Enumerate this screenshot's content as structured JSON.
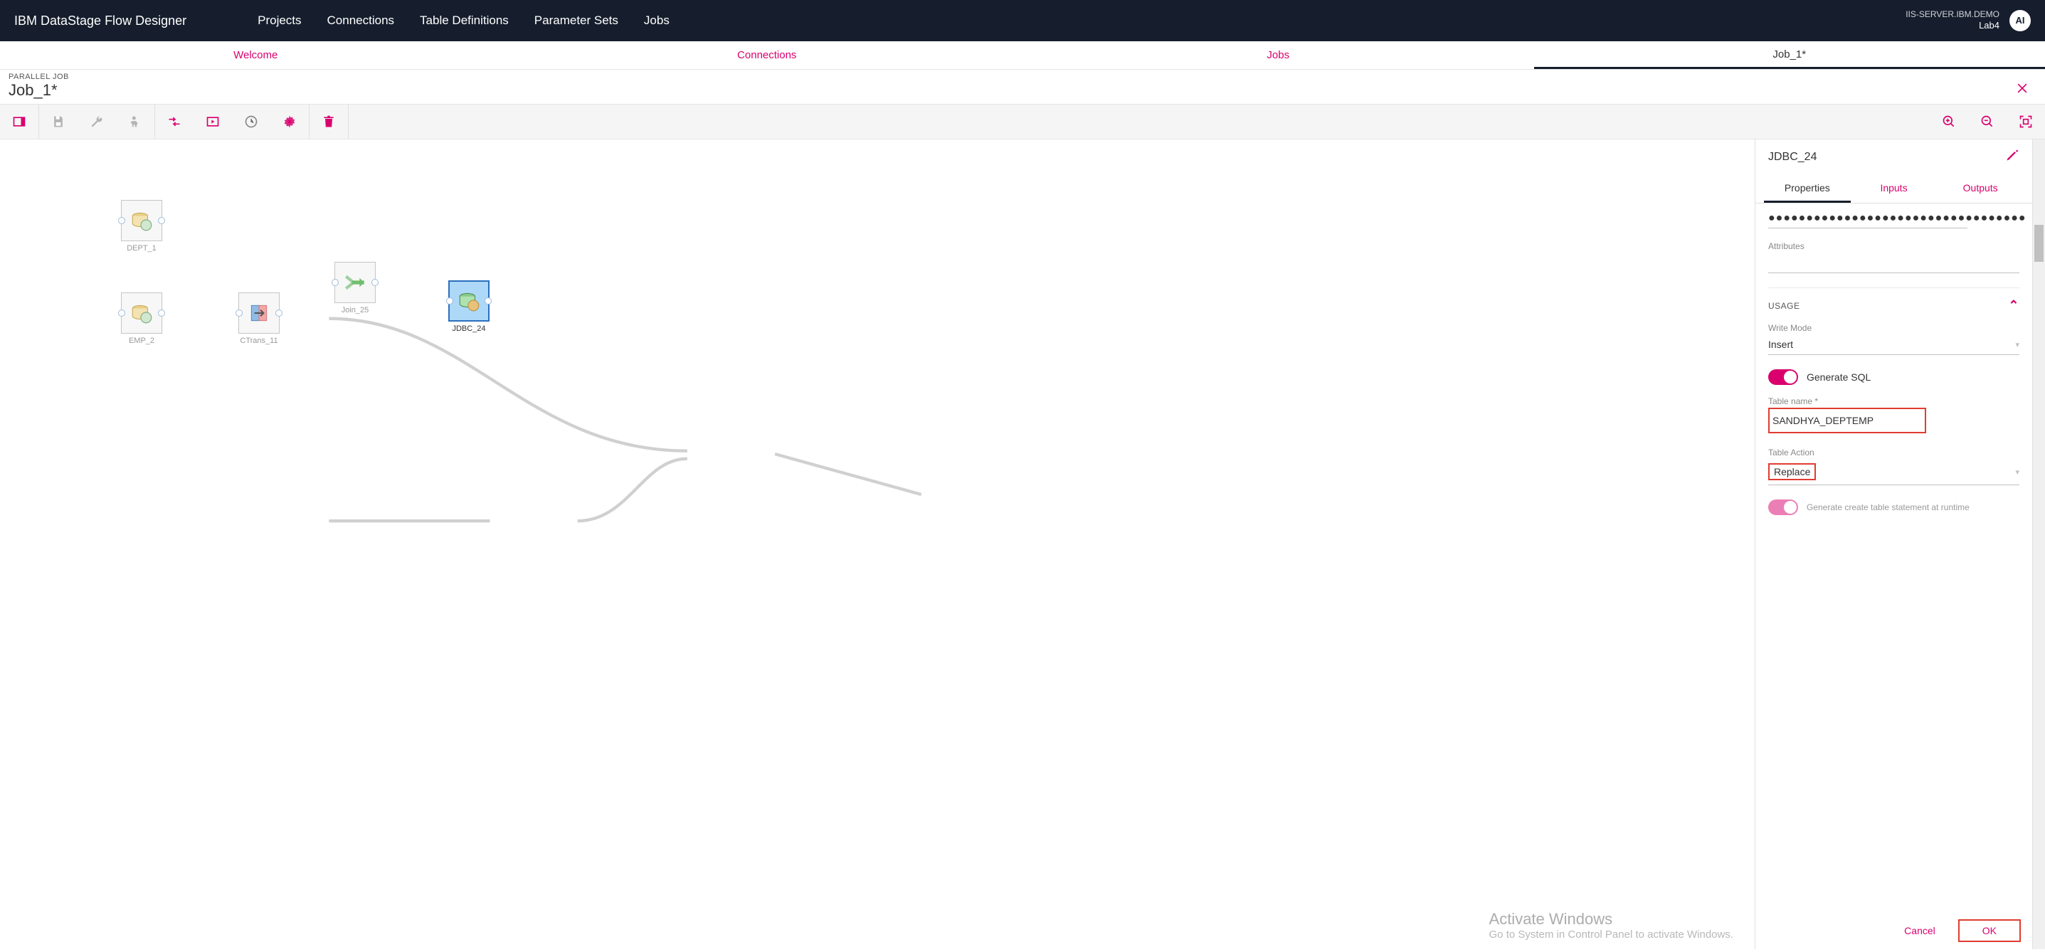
{
  "header": {
    "brand": "IBM DataStage Flow Designer",
    "nav": [
      "Projects",
      "Connections",
      "Table Definitions",
      "Parameter Sets",
      "Jobs"
    ],
    "server_line1": "IIS-SERVER.IBM.DEMO",
    "server_line2": "Lab4",
    "avatar": "AI"
  },
  "tabs": {
    "items": [
      "Welcome",
      "Connections",
      "Jobs",
      "Job_1*"
    ],
    "active_index": 3
  },
  "job": {
    "kind": "PARALLEL JOB",
    "name": "Job_1*"
  },
  "canvas": {
    "nodes": {
      "dept": {
        "label": "DEPT_1"
      },
      "emp": {
        "label": "EMP_2"
      },
      "ctrans": {
        "label": "CTrans_11"
      },
      "join": {
        "label": "Join_25"
      },
      "jdbc": {
        "label": "JDBC_24"
      }
    }
  },
  "panel": {
    "title": "JDBC_24",
    "tabs": [
      "Properties",
      "Inputs",
      "Outputs"
    ],
    "active_tab": 0,
    "password_mask": "●●●●●●●●●●●●●●●●●●●●●●●●●●●●●●●●●●",
    "attributes_label": "Attributes",
    "attributes_value": "",
    "usage_section": "USAGE",
    "write_mode_label": "Write Mode",
    "write_mode_value": "Insert",
    "generate_sql_label": "Generate SQL",
    "generate_sql_on": true,
    "table_name_label": "Table name *",
    "table_name_value": "SANDHYA_DEPTEMP",
    "table_action_label": "Table Action",
    "table_action_value": "Replace",
    "generate_create_label": "Generate create table statement at runtime",
    "cancel": "Cancel",
    "ok": "OK"
  },
  "watermark": {
    "line1": "Activate Windows",
    "line2": "Go to System in Control Panel to activate Windows."
  }
}
